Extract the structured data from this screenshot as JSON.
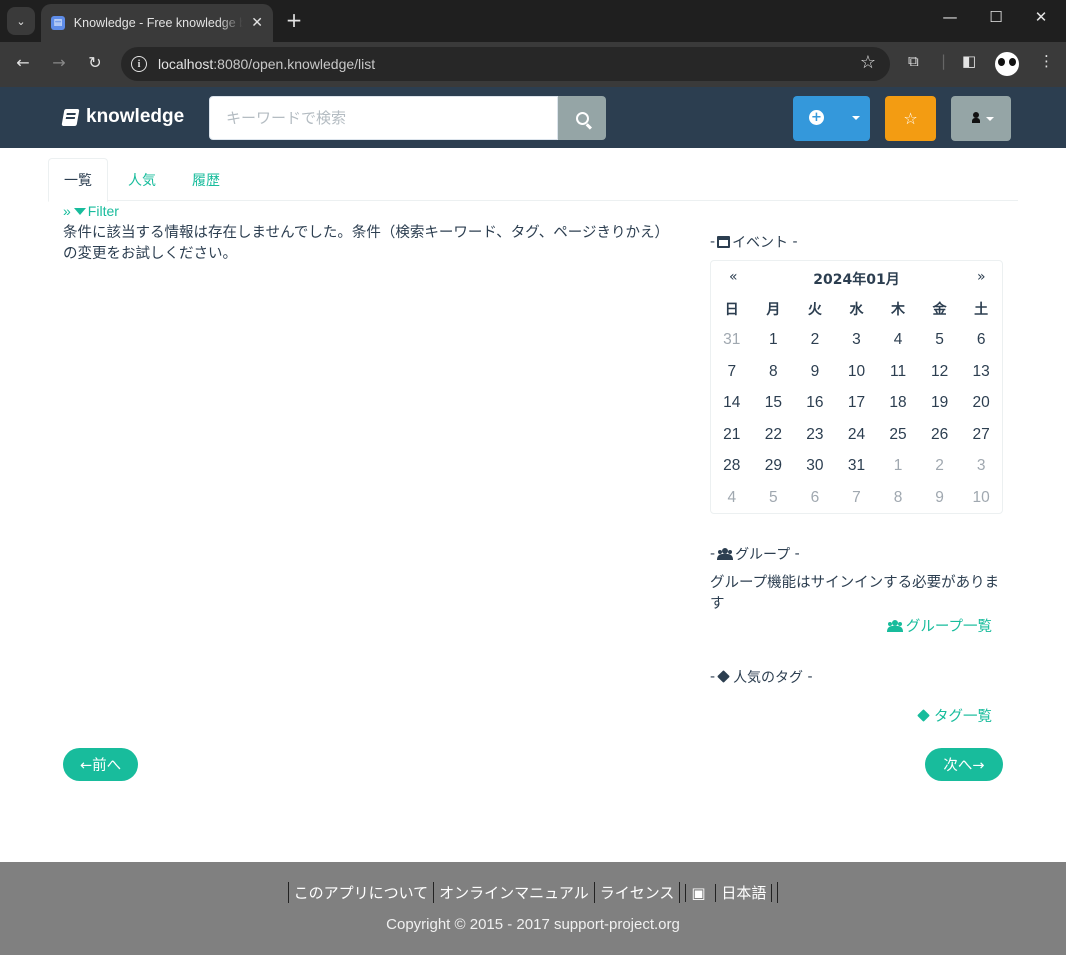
{
  "browser": {
    "tab_title": "Knowledge - Free knowledge base",
    "url_host": "localhost",
    "url_rest": ":8080/open.knowledge/list"
  },
  "navbar": {
    "brand": "knowledge",
    "search_placeholder": "キーワードで検索"
  },
  "tabs": [
    {
      "label": "一覧",
      "active": true
    },
    {
      "label": "人気",
      "active": false
    },
    {
      "label": "履歴",
      "active": false
    }
  ],
  "filter_label": "Filter",
  "message": "条件に該当する情報は存在しませんでした。条件（検索キーワード、タグ、ページきりかえ）の変更をお試しください。",
  "events": {
    "title": "イベント",
    "month_label": "2024年01月",
    "prev": "«",
    "next": "»",
    "weekdays": [
      "日",
      "月",
      "火",
      "水",
      "木",
      "金",
      "土"
    ],
    "weeks": [
      [
        "31",
        "1",
        "2",
        "3",
        "4",
        "5",
        "6"
      ],
      [
        "7",
        "8",
        "9",
        "10",
        "11",
        "12",
        "13"
      ],
      [
        "14",
        "15",
        "16",
        "17",
        "18",
        "19",
        "20"
      ],
      [
        "21",
        "22",
        "23",
        "24",
        "25",
        "26",
        "27"
      ],
      [
        "28",
        "29",
        "30",
        "31",
        "1",
        "2",
        "3"
      ],
      [
        "4",
        "5",
        "6",
        "7",
        "8",
        "9",
        "10"
      ]
    ]
  },
  "groups": {
    "title": "グループ",
    "note": "グループ機能はサインインする必要があります",
    "link": "グループ一覧"
  },
  "popular_tags": {
    "title": "人気のタグ",
    "link": "タグ一覧"
  },
  "pager": {
    "prev": "←前へ",
    "next": "次へ→"
  },
  "footer": {
    "links": [
      "このアプリについて",
      "オンラインマニュアル",
      "ライセンス",
      "日本語"
    ],
    "copyright": "Copyright © 2015 - 2017 support-project.org"
  }
}
